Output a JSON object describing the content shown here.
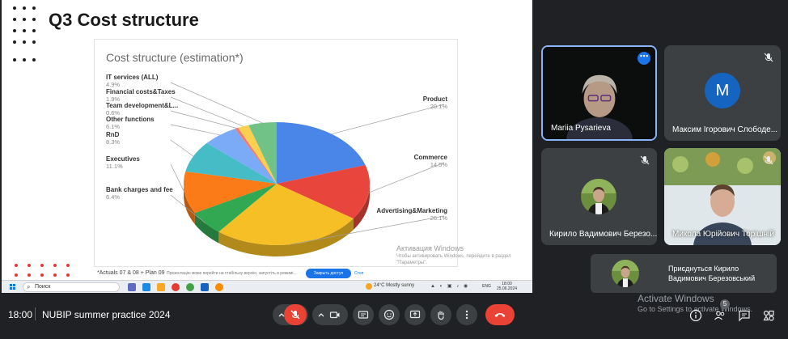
{
  "slide": {
    "title": "Q3 Cost structure",
    "actuals_note": "*Actuals 07 & 08 + Plan 09",
    "notice_text": "Презентацію може перейти на стабільну версію, запустіть в режимі...",
    "notice_button": "Закрыть доступ",
    "notice_link": "Стоп",
    "watermark_title": "Активация Windows",
    "watermark_sub": "Чтобы активировать Windows, перейдите в раздел \"Параметры\"."
  },
  "chart_data": {
    "type": "pie",
    "title": "Cost structure (estimation*)",
    "slices": [
      {
        "label": "Product",
        "percent": "20.1%",
        "value": 20.1,
        "color": "#4a86e8"
      },
      {
        "label": "Commerce",
        "percent": "14.5%",
        "value": 14.5,
        "color": "#e8453c"
      },
      {
        "label": "Advertising&Marketing",
        "percent": "26.1%",
        "value": 26.1,
        "color": "#f6bf26"
      },
      {
        "label": "Bank charges and fee",
        "percent": "6.4%",
        "value": 6.4,
        "color": "#33a853"
      },
      {
        "label": "Executives",
        "percent": "11.1%",
        "value": 11.1,
        "color": "#fa7b17"
      },
      {
        "label": "RnD",
        "percent": "8.3%",
        "value": 8.3,
        "color": "#46bdc6"
      },
      {
        "label": "Other functions",
        "percent": "6.1%",
        "value": 6.1,
        "color": "#7baaf7"
      },
      {
        "label": "Team development&L...",
        "percent": "0.6%",
        "value": 0.6,
        "color": "#f07b72"
      },
      {
        "label": "Financial costs&Taxes",
        "percent": "1.9%",
        "value": 1.9,
        "color": "#fcd04f"
      },
      {
        "label": "IT services (ALL)",
        "percent": "4.9%",
        "value": 4.9,
        "color": "#71c287"
      }
    ]
  },
  "taskbar": {
    "search_label": "Поиск",
    "weather": "24°C  Mostly sunny",
    "lang": "ENG",
    "clock_time": "18:00",
    "clock_date": "25.06.2024"
  },
  "participants": [
    {
      "name": "Mariia Pysarieva"
    },
    {
      "name": "Максим Ігорович Слободе...",
      "initial": "M"
    },
    {
      "name": "Кирило Вадимович Березо..."
    },
    {
      "name": "Микола Юрійович Торішній"
    }
  ],
  "join_notice": "Приєднуться Кирило Вадимович Березовський",
  "windows_activation": {
    "title": "Activate Windows",
    "sub": "Go to Settings to activate Windows."
  },
  "meet": {
    "time": "18:00",
    "title": "NUBIP summer practice 2024",
    "people_count": "5",
    "colors": {
      "end_call": "#ea4335",
      "mic_off": "#ea4335",
      "control": "#3c4043"
    }
  }
}
